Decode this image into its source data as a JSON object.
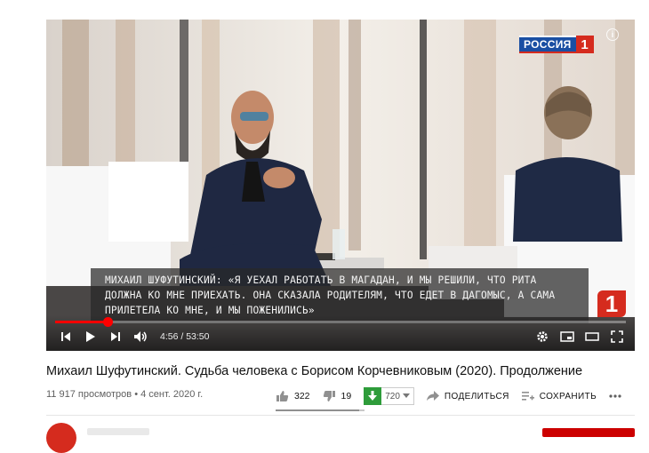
{
  "player": {
    "channel_logo_text": "РОССИЯ",
    "channel_logo_number": "1",
    "info_icon": "info-icon",
    "subtitle": "МИХАИЛ ШУФУТИНСКИЙ: «Я УЕХАЛ РАБОТАТЬ В МАГАДАН, И МЫ РЕШИЛИ, ЧТО РИТА ДОЛЖНА КО МНЕ ПРИЕХАТЬ. ОНА СКАЗАЛА РОДИТЕЛЯМ, ЧТО ЕДЕТ В ДАГОМЫС, А САМА ПРИЛЕТЕЛА КО МНЕ, И МЫ ПОЖЕНИЛИСЬ»",
    "corner_badge": "1",
    "current_time": "4:56",
    "duration": "53:50",
    "time_display": "4:56 / 53:50",
    "progress_fraction": 0.092,
    "controls_left": [
      "prev-icon",
      "play-icon",
      "next-icon",
      "volume-icon"
    ],
    "controls_right": [
      "settings-icon",
      "miniplayer-icon",
      "theater-icon",
      "fullscreen-icon"
    ],
    "accent_color": "#ff0000"
  },
  "video": {
    "title": "Михаил Шуфутинский. Судьба человека с Борисом Корчевниковым (2020). Продолжение",
    "views_and_date": "11 917 просмотров • 4 сент. 2020 г.",
    "likes": "322",
    "dislikes": "19",
    "like_ratio": 0.944,
    "download_resolution": "720",
    "share_label": "ПОДЕЛИТЬСЯ",
    "save_label": "СОХРАНИТЬ",
    "more_icon": "more-icon",
    "download_color": "#2e9c3a"
  }
}
